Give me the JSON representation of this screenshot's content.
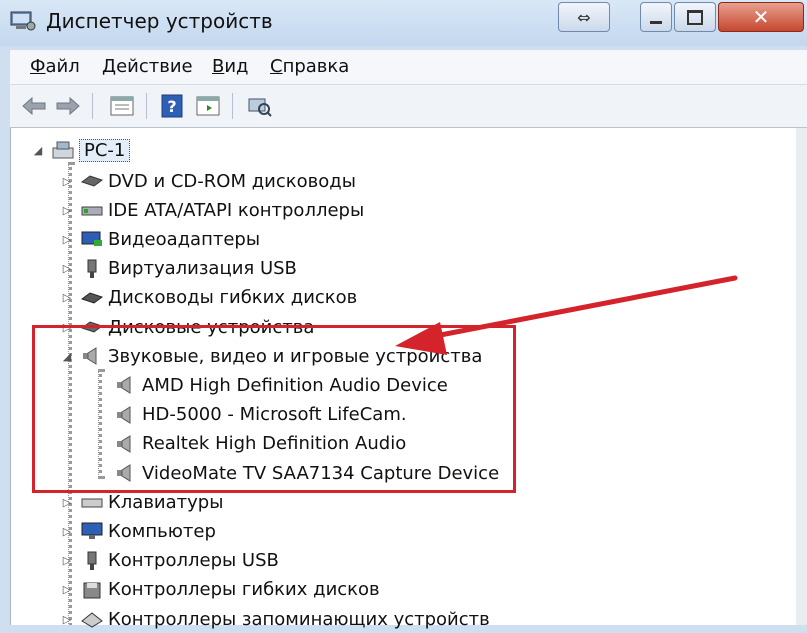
{
  "window": {
    "title": "Диспетчер устройств"
  },
  "menu": [
    {
      "underline": "Ф",
      "rest": "айл"
    },
    {
      "underline": "Д",
      "rest": "ействие"
    },
    {
      "underline": "В",
      "rest": "ид"
    },
    {
      "underline": "С",
      "rest": "правка"
    }
  ],
  "toolbar": {
    "icons": [
      "back-arrow-icon",
      "forward-arrow-icon",
      "properties-icon",
      "help-icon",
      "view-icon",
      "scan-hardware-icon"
    ]
  },
  "tree": {
    "root": {
      "label": "PC-1",
      "icon": "computer-icon"
    },
    "categories": [
      {
        "label": "DVD и CD-ROM дисководы",
        "icon": "dvd-drive-icon"
      },
      {
        "label": "IDE ATA/ATAPI контроллеры",
        "icon": "ide-controller-icon"
      },
      {
        "label": "Видеоадаптеры",
        "icon": "display-adapter-icon"
      },
      {
        "label": "Виртуализация USB",
        "icon": "usb-icon"
      },
      {
        "label": "Дисководы гибких дисков",
        "icon": "floppy-drive-icon"
      },
      {
        "label": "Дисковые устройства",
        "icon": "disk-drive-icon"
      },
      {
        "label": "Звуковые, видео и игровые устройства",
        "icon": "speaker-icon",
        "expanded": true
      },
      {
        "label": "Клавиатуры",
        "icon": "keyboard-icon"
      },
      {
        "label": "Компьютер",
        "icon": "monitor-icon"
      },
      {
        "label": "Контроллеры USB",
        "icon": "usb-icon"
      },
      {
        "label": "Контроллеры гибких дисков",
        "icon": "floppy-controller-icon"
      },
      {
        "label": "Контроллеры запоминающих устройств",
        "icon": "storage-controller-icon"
      }
    ],
    "sound_devices": [
      {
        "label": "AMD High Definition Audio Device",
        "icon": "speaker-icon"
      },
      {
        "label": "HD-5000 - Microsoft LifeCam.",
        "icon": "speaker-icon"
      },
      {
        "label": "Realtek High Definition Audio",
        "icon": "speaker-icon"
      },
      {
        "label": "VideoMate TV SAA7134 Capture Device",
        "icon": "speaker-icon"
      }
    ]
  },
  "annotation": {
    "color": "#d5232b"
  }
}
